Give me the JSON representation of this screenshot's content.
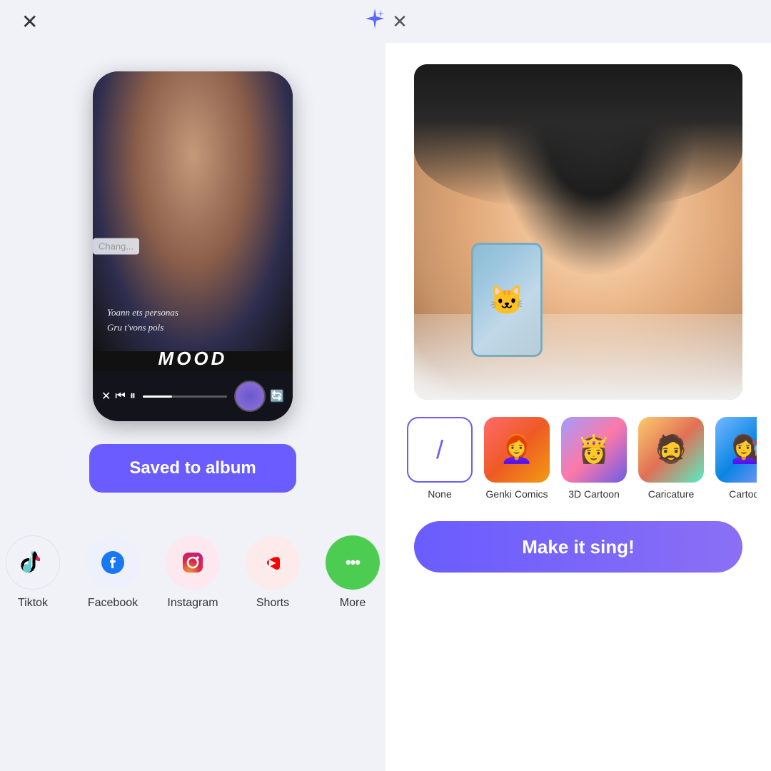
{
  "topbar": {
    "close_left": "✕",
    "sparkle": "✦",
    "close_center": "✕"
  },
  "left_panel": {
    "phone": {
      "song_line1": "Yoann ets personas",
      "song_line2": "Gru t'vons pols",
      "mood_text": "MOOD",
      "change_label": "Chang..."
    },
    "saved_btn_label": "Saved to album",
    "share_items": [
      {
        "id": "tiktok",
        "label": "Tiktok",
        "icon": "tiktok"
      },
      {
        "id": "facebook",
        "label": "Facebook",
        "icon": "f"
      },
      {
        "id": "instagram",
        "label": "Instagram",
        "icon": "ig"
      },
      {
        "id": "shorts",
        "label": "Shorts",
        "icon": "shorts"
      },
      {
        "id": "more",
        "label": "More",
        "icon": "..."
      }
    ]
  },
  "right_panel": {
    "filter_items": [
      {
        "id": "none",
        "label": "None",
        "type": "none"
      },
      {
        "id": "genki",
        "label": "Genki Comics",
        "type": "genki"
      },
      {
        "id": "3dcartoon",
        "label": "3D Cartoon",
        "type": "3dcartoon"
      },
      {
        "id": "caricature",
        "label": "Caricature",
        "type": "caricature"
      },
      {
        "id": "cartoon",
        "label": "Cartoo...",
        "type": "cartoon"
      }
    ],
    "make_sing_label": "Make it sing!"
  }
}
